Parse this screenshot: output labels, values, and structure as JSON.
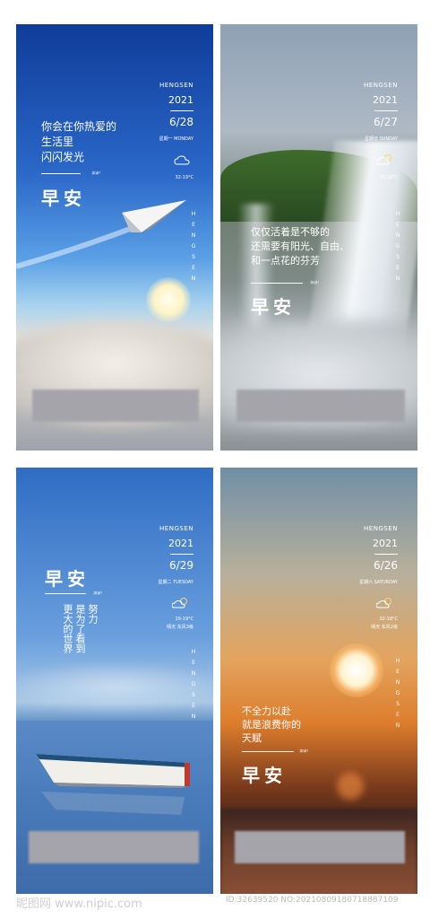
{
  "colors": {
    "text": "#ffffff",
    "mask": "#a5a4ab"
  },
  "posters": [
    {
      "brand": "HENGSEN",
      "year": "2021",
      "date": "6/28",
      "weekday": "星期一 MONDAY",
      "temp": "32-19°C",
      "quote": [
        "你会在你热爱的",
        "生活里",
        "闪闪发光"
      ],
      "tag": "加油！",
      "greeting": "早安",
      "vertical": [
        "H",
        "E",
        "N",
        "G",
        "S",
        "E",
        "N"
      ],
      "weather_icon": "cloud-icon",
      "image_icon": "paper-plane-icon"
    },
    {
      "brand": "HENGSEN",
      "year": "2021",
      "date": "6/27",
      "weekday": "星期日 SUNDAY",
      "temp": "33-18°C",
      "quote": [
        "仅仅活着是不够的",
        "还需要有阳光、自由、",
        "和一点花的芬芳"
      ],
      "tag": "加油！",
      "greeting": "早安",
      "vertical": [
        "H",
        "E",
        "N",
        "G",
        "S",
        "E",
        "N"
      ],
      "weather_icon": "sun-cloud-icon"
    },
    {
      "brand": "HENGSEN",
      "year": "2021",
      "date": "6/29",
      "weekday": "星期二 TUESDAY",
      "temp": "29-19°C",
      "temp_sub": "晴天  东风3级",
      "quote_cols": [
        "努力",
        "是为了看到",
        "更大的世界"
      ],
      "tag": "加油！",
      "greeting": "早安",
      "vertical": [
        "H",
        "E",
        "N",
        "G",
        "S",
        "E",
        "N"
      ],
      "weather_icon": "sun-cloud-icon",
      "image_icon": "boat-icon"
    },
    {
      "brand": "HENGSEN",
      "year": "2021",
      "date": "6/26",
      "weekday": "星期六 SATURDAY",
      "temp": "32-18°C",
      "temp_sub": "晴天  东风2级",
      "quote": [
        "不全力以赴",
        "就是浪费你的",
        "天赋"
      ],
      "tag": "加油！",
      "greeting": "早安",
      "vertical": [
        "H",
        "E",
        "N",
        "G",
        "S",
        "E",
        "N"
      ],
      "weather_icon": "sun-cloud-icon"
    }
  ],
  "footer": {
    "watermark": "昵图网 www.nipic.com",
    "id": "ID:32639520 NO:20210809180718887109"
  }
}
